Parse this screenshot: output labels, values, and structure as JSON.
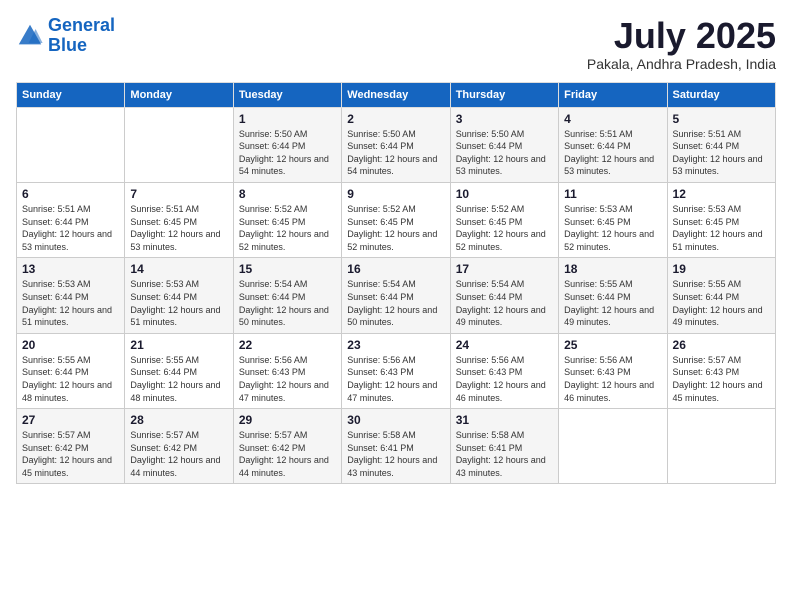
{
  "logo": {
    "line1": "General",
    "line2": "Blue"
  },
  "title": "July 2025",
  "location": "Pakala, Andhra Pradesh, India",
  "weekdays": [
    "Sunday",
    "Monday",
    "Tuesday",
    "Wednesday",
    "Thursday",
    "Friday",
    "Saturday"
  ],
  "weeks": [
    [
      {
        "day": "",
        "sunrise": "",
        "sunset": "",
        "daylight": ""
      },
      {
        "day": "",
        "sunrise": "",
        "sunset": "",
        "daylight": ""
      },
      {
        "day": "1",
        "sunrise": "Sunrise: 5:50 AM",
        "sunset": "Sunset: 6:44 PM",
        "daylight": "Daylight: 12 hours and 54 minutes."
      },
      {
        "day": "2",
        "sunrise": "Sunrise: 5:50 AM",
        "sunset": "Sunset: 6:44 PM",
        "daylight": "Daylight: 12 hours and 54 minutes."
      },
      {
        "day": "3",
        "sunrise": "Sunrise: 5:50 AM",
        "sunset": "Sunset: 6:44 PM",
        "daylight": "Daylight: 12 hours and 53 minutes."
      },
      {
        "day": "4",
        "sunrise": "Sunrise: 5:51 AM",
        "sunset": "Sunset: 6:44 PM",
        "daylight": "Daylight: 12 hours and 53 minutes."
      },
      {
        "day": "5",
        "sunrise": "Sunrise: 5:51 AM",
        "sunset": "Sunset: 6:44 PM",
        "daylight": "Daylight: 12 hours and 53 minutes."
      }
    ],
    [
      {
        "day": "6",
        "sunrise": "Sunrise: 5:51 AM",
        "sunset": "Sunset: 6:44 PM",
        "daylight": "Daylight: 12 hours and 53 minutes."
      },
      {
        "day": "7",
        "sunrise": "Sunrise: 5:51 AM",
        "sunset": "Sunset: 6:45 PM",
        "daylight": "Daylight: 12 hours and 53 minutes."
      },
      {
        "day": "8",
        "sunrise": "Sunrise: 5:52 AM",
        "sunset": "Sunset: 6:45 PM",
        "daylight": "Daylight: 12 hours and 52 minutes."
      },
      {
        "day": "9",
        "sunrise": "Sunrise: 5:52 AM",
        "sunset": "Sunset: 6:45 PM",
        "daylight": "Daylight: 12 hours and 52 minutes."
      },
      {
        "day": "10",
        "sunrise": "Sunrise: 5:52 AM",
        "sunset": "Sunset: 6:45 PM",
        "daylight": "Daylight: 12 hours and 52 minutes."
      },
      {
        "day": "11",
        "sunrise": "Sunrise: 5:53 AM",
        "sunset": "Sunset: 6:45 PM",
        "daylight": "Daylight: 12 hours and 52 minutes."
      },
      {
        "day": "12",
        "sunrise": "Sunrise: 5:53 AM",
        "sunset": "Sunset: 6:45 PM",
        "daylight": "Daylight: 12 hours and 51 minutes."
      }
    ],
    [
      {
        "day": "13",
        "sunrise": "Sunrise: 5:53 AM",
        "sunset": "Sunset: 6:44 PM",
        "daylight": "Daylight: 12 hours and 51 minutes."
      },
      {
        "day": "14",
        "sunrise": "Sunrise: 5:53 AM",
        "sunset": "Sunset: 6:44 PM",
        "daylight": "Daylight: 12 hours and 51 minutes."
      },
      {
        "day": "15",
        "sunrise": "Sunrise: 5:54 AM",
        "sunset": "Sunset: 6:44 PM",
        "daylight": "Daylight: 12 hours and 50 minutes."
      },
      {
        "day": "16",
        "sunrise": "Sunrise: 5:54 AM",
        "sunset": "Sunset: 6:44 PM",
        "daylight": "Daylight: 12 hours and 50 minutes."
      },
      {
        "day": "17",
        "sunrise": "Sunrise: 5:54 AM",
        "sunset": "Sunset: 6:44 PM",
        "daylight": "Daylight: 12 hours and 49 minutes."
      },
      {
        "day": "18",
        "sunrise": "Sunrise: 5:55 AM",
        "sunset": "Sunset: 6:44 PM",
        "daylight": "Daylight: 12 hours and 49 minutes."
      },
      {
        "day": "19",
        "sunrise": "Sunrise: 5:55 AM",
        "sunset": "Sunset: 6:44 PM",
        "daylight": "Daylight: 12 hours and 49 minutes."
      }
    ],
    [
      {
        "day": "20",
        "sunrise": "Sunrise: 5:55 AM",
        "sunset": "Sunset: 6:44 PM",
        "daylight": "Daylight: 12 hours and 48 minutes."
      },
      {
        "day": "21",
        "sunrise": "Sunrise: 5:55 AM",
        "sunset": "Sunset: 6:44 PM",
        "daylight": "Daylight: 12 hours and 48 minutes."
      },
      {
        "day": "22",
        "sunrise": "Sunrise: 5:56 AM",
        "sunset": "Sunset: 6:43 PM",
        "daylight": "Daylight: 12 hours and 47 minutes."
      },
      {
        "day": "23",
        "sunrise": "Sunrise: 5:56 AM",
        "sunset": "Sunset: 6:43 PM",
        "daylight": "Daylight: 12 hours and 47 minutes."
      },
      {
        "day": "24",
        "sunrise": "Sunrise: 5:56 AM",
        "sunset": "Sunset: 6:43 PM",
        "daylight": "Daylight: 12 hours and 46 minutes."
      },
      {
        "day": "25",
        "sunrise": "Sunrise: 5:56 AM",
        "sunset": "Sunset: 6:43 PM",
        "daylight": "Daylight: 12 hours and 46 minutes."
      },
      {
        "day": "26",
        "sunrise": "Sunrise: 5:57 AM",
        "sunset": "Sunset: 6:43 PM",
        "daylight": "Daylight: 12 hours and 45 minutes."
      }
    ],
    [
      {
        "day": "27",
        "sunrise": "Sunrise: 5:57 AM",
        "sunset": "Sunset: 6:42 PM",
        "daylight": "Daylight: 12 hours and 45 minutes."
      },
      {
        "day": "28",
        "sunrise": "Sunrise: 5:57 AM",
        "sunset": "Sunset: 6:42 PM",
        "daylight": "Daylight: 12 hours and 44 minutes."
      },
      {
        "day": "29",
        "sunrise": "Sunrise: 5:57 AM",
        "sunset": "Sunset: 6:42 PM",
        "daylight": "Daylight: 12 hours and 44 minutes."
      },
      {
        "day": "30",
        "sunrise": "Sunrise: 5:58 AM",
        "sunset": "Sunset: 6:41 PM",
        "daylight": "Daylight: 12 hours and 43 minutes."
      },
      {
        "day": "31",
        "sunrise": "Sunrise: 5:58 AM",
        "sunset": "Sunset: 6:41 PM",
        "daylight": "Daylight: 12 hours and 43 minutes."
      },
      {
        "day": "",
        "sunrise": "",
        "sunset": "",
        "daylight": ""
      },
      {
        "day": "",
        "sunrise": "",
        "sunset": "",
        "daylight": ""
      }
    ]
  ]
}
